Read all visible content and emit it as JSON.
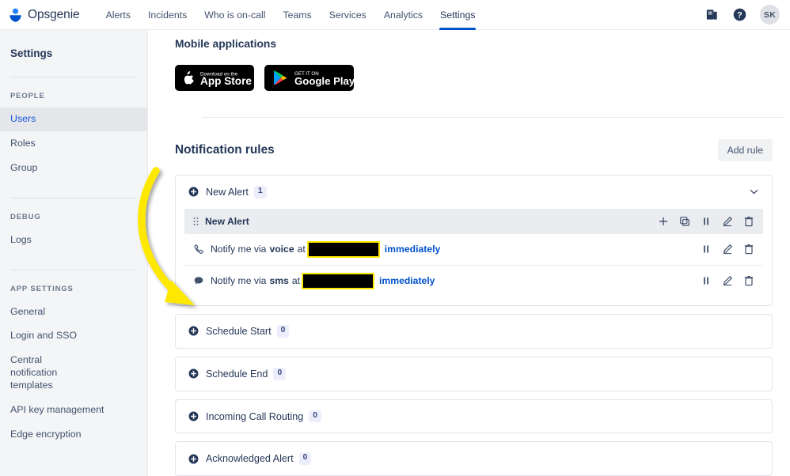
{
  "header": {
    "brand": "Opsgenie",
    "brand_logo_icon": "opsgenie-logo-icon",
    "nav": [
      {
        "label": "Alerts",
        "active": false
      },
      {
        "label": "Incidents",
        "active": false
      },
      {
        "label": "Who is on-call",
        "active": false
      },
      {
        "label": "Teams",
        "active": false
      },
      {
        "label": "Services",
        "active": false
      },
      {
        "label": "Analytics",
        "active": false
      },
      {
        "label": "Settings",
        "active": true
      }
    ],
    "icons": [
      "docs-icon",
      "help-icon"
    ],
    "avatar_initials": "SK",
    "accent_color": "#0052cc"
  },
  "sidebar": {
    "title": "Settings",
    "groups": [
      {
        "label": "PEOPLE",
        "items": [
          {
            "label": "Users",
            "active": true
          },
          {
            "label": "Roles",
            "active": false
          },
          {
            "label": "Group",
            "active": false
          }
        ]
      },
      {
        "label": "DEBUG",
        "items": [
          {
            "label": "Logs",
            "active": false
          }
        ]
      },
      {
        "label": "APP SETTINGS",
        "items": [
          {
            "label": "General",
            "active": false
          },
          {
            "label": "Login and SSO",
            "active": false
          },
          {
            "label": "Central notification templates",
            "active": false
          },
          {
            "label": "API key management",
            "active": false
          },
          {
            "label": "Edge encryption",
            "active": false
          }
        ]
      }
    ]
  },
  "mobile": {
    "title": "Mobile applications",
    "badges": [
      {
        "name": "app-store-badge",
        "small_text": "Download on the",
        "big_text": "App Store"
      },
      {
        "name": "google-play-badge",
        "small_text": "GET IT ON",
        "big_text": "Google Play"
      }
    ]
  },
  "rules": {
    "title": "Notification rules",
    "add_button": "Add rule",
    "expanded": {
      "name": "New Alert",
      "count": "1",
      "row_header": {
        "name": "New Alert",
        "actions": [
          "add-icon",
          "duplicate-icon",
          "pause-icon",
          "edit-icon",
          "delete-icon"
        ]
      },
      "rows": [
        {
          "icon": "phone-icon",
          "prefix": "Notify me via",
          "channel": "voice",
          "middle": "at",
          "redacted": true,
          "timing": "immediately",
          "actions": [
            "pause-icon",
            "edit-icon",
            "delete-icon"
          ]
        },
        {
          "icon": "sms-icon",
          "prefix": "Notify me via",
          "channel": "sms",
          "middle": "at",
          "redacted": true,
          "timing": "immediately",
          "actions": [
            "pause-icon",
            "edit-icon",
            "delete-icon"
          ]
        }
      ]
    },
    "collapsed": [
      {
        "name": "Schedule Start",
        "count": "0"
      },
      {
        "name": "Schedule End",
        "count": "0"
      },
      {
        "name": "Incoming Call Routing",
        "count": "0"
      },
      {
        "name": "Acknowledged Alert",
        "count": "0"
      }
    ]
  },
  "annotation": {
    "arrow_color": "#ffe800",
    "points_to": "sms notification rule row"
  }
}
